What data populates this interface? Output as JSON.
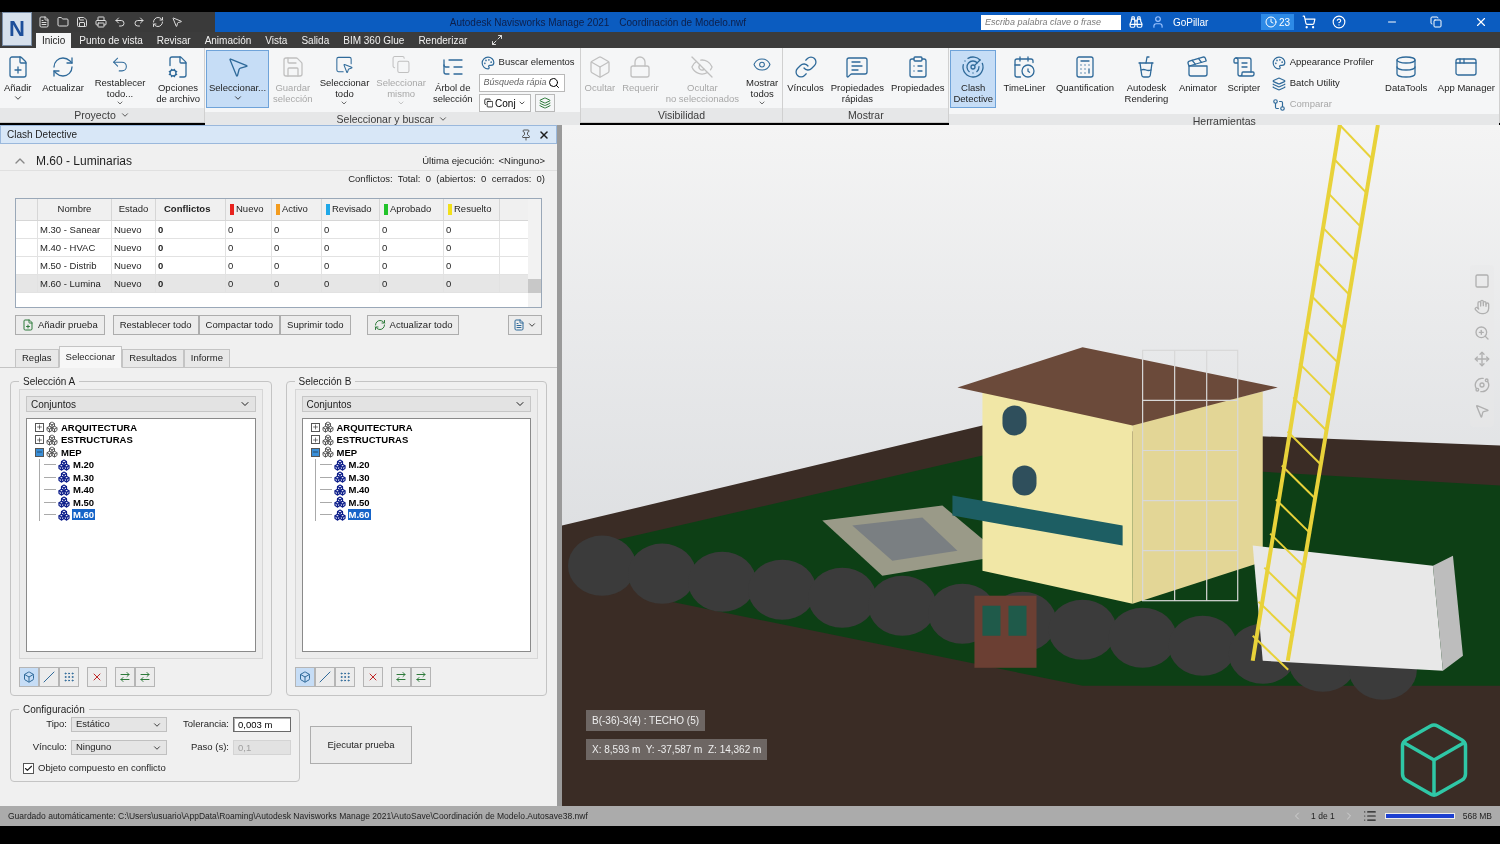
{
  "app_button": {
    "label": "N"
  },
  "title": {
    "app": "Autodesk Navisworks Manage 2021",
    "file": "Coordinación de Modelo.nwf"
  },
  "search": {
    "placeholder": "Escriba palabra clave o frase"
  },
  "user": {
    "name": "GoPillar"
  },
  "notifications": {
    "count": "23"
  },
  "ribbon_tabs": [
    {
      "label": "Inicio",
      "selected": true
    },
    {
      "label": "Punto de vista",
      "selected": false
    },
    {
      "label": "Revisar",
      "selected": false
    },
    {
      "label": "Animación",
      "selected": false
    },
    {
      "label": "Vista",
      "selected": false
    },
    {
      "label": "Salida",
      "selected": false
    },
    {
      "label": "BIM 360 Glue",
      "selected": false
    },
    {
      "label": "Renderizar",
      "selected": false
    }
  ],
  "ribbon_groups": [
    {
      "label": "Proyecto",
      "menu": true,
      "items": [
        {
          "kind": "large",
          "label": "Añadir",
          "dropdown": true,
          "disabled": false,
          "selected": false
        },
        {
          "kind": "large",
          "label": "Actualizar",
          "dropdown": false,
          "disabled": false,
          "selected": false
        },
        {
          "kind": "large",
          "label": "Restablecer\ntodo...",
          "dropdown": true,
          "disabled": false,
          "selected": false
        },
        {
          "kind": "large",
          "label": "Opciones\nde archivo",
          "dropdown": false,
          "disabled": false,
          "selected": false
        }
      ]
    },
    {
      "label": "Seleccionar y buscar",
      "menu": true,
      "items": [
        {
          "kind": "large",
          "label": "Seleccionar...",
          "dropdown": true,
          "disabled": false,
          "selected": true
        },
        {
          "kind": "large",
          "label": "Guardar\nselección",
          "dropdown": false,
          "disabled": true,
          "selected": false
        },
        {
          "kind": "large",
          "label": "Seleccionar\ntodo",
          "dropdown": true,
          "disabled": false,
          "selected": false
        },
        {
          "kind": "large",
          "label": "Seleccionar\nmismo",
          "dropdown": true,
          "disabled": true,
          "selected": false
        },
        {
          "kind": "large",
          "label": "Árbol de\nselección",
          "dropdown": false,
          "disabled": false,
          "selected": false
        },
        {
          "kind": "stack",
          "items": [
            {
              "kind": "small",
              "label": "Buscar elementos",
              "disabled": false
            },
            {
              "kind": "field",
              "placeholder": "Búsqueda rápia"
            },
            {
              "kind": "combo",
              "value": "Conj"
            }
          ]
        }
      ]
    },
    {
      "label": "Visibilidad",
      "menu": false,
      "items": [
        {
          "kind": "large",
          "label": "Ocultar",
          "dropdown": false,
          "disabled": true,
          "selected": false
        },
        {
          "kind": "large",
          "label": "Requerir",
          "dropdown": false,
          "disabled": true,
          "selected": false
        },
        {
          "kind": "large",
          "label": "Ocultar\nno seleccionados",
          "dropdown": false,
          "disabled": true,
          "selected": false
        },
        {
          "kind": "large",
          "label": "Mostrar\ntodos",
          "dropdown": true,
          "disabled": false,
          "selected": false
        }
      ]
    },
    {
      "label": "Mostrar",
      "menu": false,
      "items": [
        {
          "kind": "large",
          "label": "Vínculos",
          "dropdown": false,
          "disabled": false,
          "selected": false
        },
        {
          "kind": "large",
          "label": "Propiedades\nrápidas",
          "dropdown": false,
          "disabled": false,
          "selected": false
        },
        {
          "kind": "large",
          "label": "Propiedades",
          "dropdown": false,
          "disabled": false,
          "selected": false
        }
      ]
    },
    {
      "label": "Herramientas",
      "menu": false,
      "items": [
        {
          "kind": "large",
          "label": "Clash\nDetective",
          "dropdown": false,
          "disabled": false,
          "selected": true
        },
        {
          "kind": "large",
          "label": "TimeLiner",
          "dropdown": false,
          "disabled": false,
          "selected": false
        },
        {
          "kind": "large",
          "label": "Quantification",
          "dropdown": false,
          "disabled": false,
          "selected": false
        },
        {
          "kind": "large",
          "label": "Autodesk\nRendering",
          "dropdown": false,
          "disabled": false,
          "selected": false
        },
        {
          "kind": "large",
          "label": "Animator",
          "dropdown": false,
          "disabled": false,
          "selected": false
        },
        {
          "kind": "large",
          "label": "Scripter",
          "dropdown": false,
          "disabled": false,
          "selected": false
        },
        {
          "kind": "stack",
          "items": [
            {
              "kind": "small",
              "label": "Appearance Profiler",
              "disabled": false
            },
            {
              "kind": "small",
              "label": "Batch Utility",
              "disabled": false
            },
            {
              "kind": "small",
              "label": "Comparar",
              "disabled": true
            }
          ]
        },
        {
          "kind": "large",
          "label": "DataTools",
          "dropdown": false,
          "disabled": false,
          "selected": false
        },
        {
          "kind": "large",
          "label": "App Manager",
          "dropdown": false,
          "disabled": false,
          "selected": false
        }
      ]
    }
  ],
  "clash_panel": {
    "title": "Clash Detective",
    "test_name": "M.60 - Luminarias",
    "last_run_label": "Última ejecución:",
    "last_run": "<Ninguno>",
    "summary": "Conflictos:  Total:  0  (abiertos:  0  cerrados:  0)",
    "table": {
      "columns": [
        {
          "label": "Nombre"
        },
        {
          "label": "Estado"
        },
        {
          "label": "Conflictos"
        },
        {
          "label": "Nuevo",
          "color": "#e8231f"
        },
        {
          "label": "Activo",
          "color": "#f39c1f"
        },
        {
          "label": "Revisado",
          "color": "#1fa8e8"
        },
        {
          "label": "Aprobado",
          "color": "#22c32a"
        },
        {
          "label": "Resuelto",
          "color": "#f2e01a"
        }
      ],
      "rows": [
        {
          "cells": [
            "M.30 - Sanear",
            "Nuevo",
            "0",
            "0",
            "0",
            "0",
            "0",
            "0"
          ],
          "selected": false
        },
        {
          "cells": [
            "M.40 - HVAC",
            "Nuevo",
            "0",
            "0",
            "0",
            "0",
            "0",
            "0"
          ],
          "selected": false
        },
        {
          "cells": [
            "M.50 - Distrib",
            "Nuevo",
            "0",
            "0",
            "0",
            "0",
            "0",
            "0"
          ],
          "selected": false
        },
        {
          "cells": [
            "M.60 - Lumina",
            "Nuevo",
            "0",
            "0",
            "0",
            "0",
            "0",
            "0"
          ],
          "selected": true
        }
      ]
    },
    "buttons": [
      "Añadir prueba",
      "Restablecer todo",
      "Compactar todo",
      "Suprimir todo",
      "Actualizar todo"
    ],
    "tabs": [
      {
        "label": "Reglas",
        "selected": false
      },
      {
        "label": "Seleccionar",
        "selected": true
      },
      {
        "label": "Resultados",
        "selected": false
      },
      {
        "label": "Informe",
        "selected": false
      }
    ],
    "selections": [
      {
        "label": "Selección A",
        "source": "Conjuntos",
        "tree": [
          {
            "label": "ARQUITECTURA",
            "expanded": false,
            "selected": false
          },
          {
            "label": "ESTRUCTURAS",
            "expanded": false,
            "selected": false
          },
          {
            "label": "MEP",
            "expanded": true,
            "selected": false,
            "children": [
              {
                "label": "M.20",
                "selected": false
              },
              {
                "label": "M.30",
                "selected": false
              },
              {
                "label": "M.40",
                "selected": false
              },
              {
                "label": "M.50",
                "selected": false
              },
              {
                "label": "M.60",
                "selected": true
              }
            ]
          }
        ]
      },
      {
        "label": "Selección B",
        "source": "Conjuntos",
        "tree": [
          {
            "label": "ARQUITECTURA",
            "expanded": false,
            "selected": false
          },
          {
            "label": "ESTRUCTURAS",
            "expanded": false,
            "selected": false
          },
          {
            "label": "MEP",
            "expanded": true,
            "selected": false,
            "children": [
              {
                "label": "M.20",
                "selected": false
              },
              {
                "label": "M.30",
                "selected": false
              },
              {
                "label": "M.40",
                "selected": false
              },
              {
                "label": "M.50",
                "selected": false
              },
              {
                "label": "M.60",
                "selected": true
              }
            ]
          }
        ]
      }
    ],
    "settings": {
      "title": "Configuración",
      "fields": [
        {
          "label": "Tipo:",
          "value": "Estático",
          "kind": "select"
        },
        {
          "label": "Tolerancia:",
          "value": "0,003 m",
          "kind": "input",
          "disabled": false
        },
        {
          "label": "Vínculo:",
          "value": "Ninguno",
          "kind": "select"
        },
        {
          "label": "Paso (s):",
          "value": "0,1",
          "kind": "input",
          "disabled": true
        }
      ],
      "composite": {
        "label": "Objeto compuesto en conflicto",
        "checked": true
      },
      "run_button": "Ejecutar prueba"
    }
  },
  "viewport": {
    "selection_label": "B(-36)-3(4) : TECHO (5)",
    "coordinates": "X: 8,593 m  Y: -37,587 m  Z: 14,362 m"
  },
  "status_bar": {
    "message": "Guardado automáticamente: C:\\Users\\usuario\\AppData\\Roaming\\Autodesk Navisworks Manage 2021\\AutoSave\\Coordinación de Modelo.Autosave38.nwf",
    "page": "1 de 1",
    "memory": "568 MB"
  }
}
